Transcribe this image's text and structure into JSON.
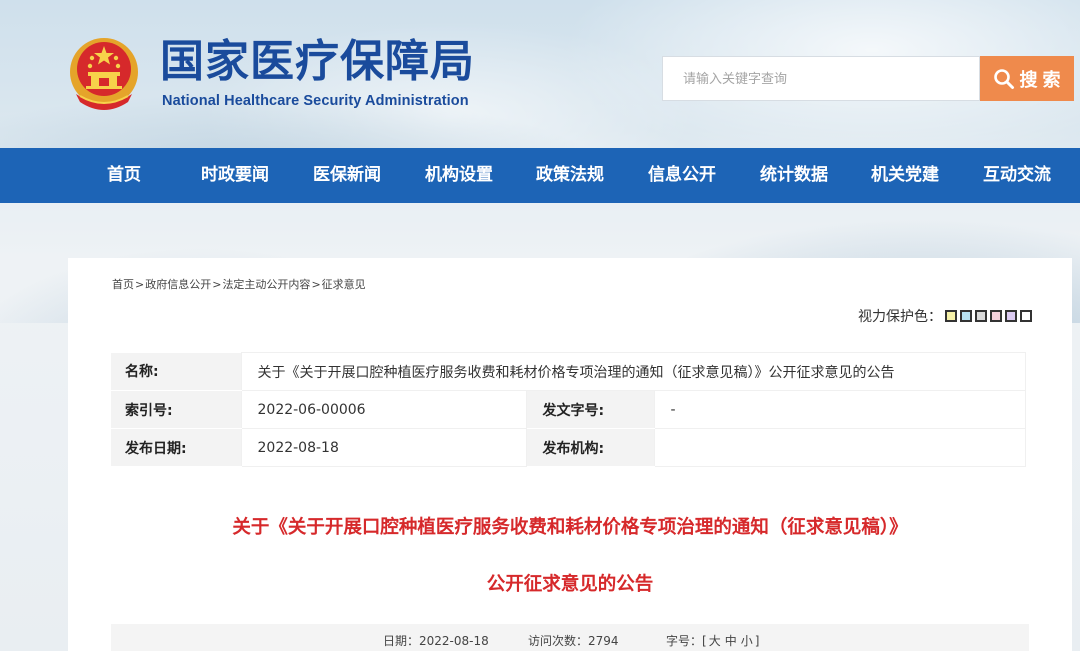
{
  "site": {
    "title_cn": "国家医疗保障局",
    "title_en": "National Healthcare Security Administration",
    "emblem_icon": "national-emblem-icon"
  },
  "search": {
    "placeholder": "请输入关键字查询",
    "button_label": "搜 索",
    "button_color": "#ef8a4c"
  },
  "nav": {
    "color": "#1d64b6",
    "items": [
      "首页",
      "时政要闻",
      "医保新闻",
      "机构设置",
      "政策法规",
      "信息公开",
      "统计数据",
      "机关党建",
      "互动交流"
    ]
  },
  "breadcrumb": [
    "首页",
    "政府信息公开",
    "法定主动公开内容",
    "征求意见"
  ],
  "vision": {
    "label": "视力保护色：",
    "swatches": [
      "#f6f1a8",
      "#b9e3f3",
      "#d9d9d9",
      "#f5d2dc",
      "#dccbf2",
      "#ffffff"
    ]
  },
  "meta": {
    "name_label": "名称:",
    "name_value": "关于《关于开展口腔种植医疗服务收费和耗材价格专项治理的通知（征求意见稿）》公开征求意见的公告",
    "index_label": "索引号:",
    "index_value": "2022-06-00006",
    "doc_no_label": "发文字号:",
    "doc_no_value": "-",
    "date_label": "发布日期:",
    "date_value": "2022-08-18",
    "org_label": "发布机构:",
    "org_value": ""
  },
  "article": {
    "title_line1": "关于《关于开展口腔种植医疗服务收费和耗材价格专项治理的通知（征求意见稿）》",
    "title_line2": "公开征求意见的公告",
    "title_color": "#d6292b"
  },
  "info": {
    "date_label": "日期：",
    "date": "2022-08-18",
    "visits_label": "访问次数：",
    "visits": "2794",
    "font_label": "字号：",
    "font_open": "[",
    "font_large": "大",
    "font_medium": "中",
    "font_small": "小",
    "font_close": "]"
  }
}
